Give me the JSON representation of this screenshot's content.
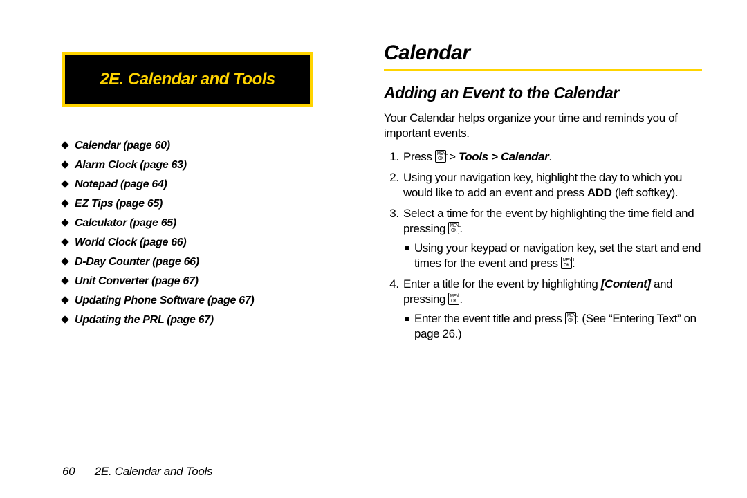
{
  "banner": {
    "title": "2E.  Calendar and Tools"
  },
  "toc": [
    "Calendar (page 60)",
    "Alarm Clock (page 63)",
    "Notepad (page 64)",
    "EZ Tips (page 65)",
    "Calculator (page 65)",
    "World Clock (page 66)",
    "D-Day Counter (page 66)",
    "Unit Converter (page 67)",
    "Updating Phone Software (page 67)",
    "Updating the PRL (page 67)"
  ],
  "heading1": "Calendar",
  "heading2": "Adding an Event to the Calendar",
  "intro": "Your Calendar helps organize your time and reminds you of important events.",
  "steps": {
    "s1": {
      "a": "Press ",
      "key": "MENU OK",
      "b": " > ",
      "tools": "Tools > Calendar",
      "c": "."
    },
    "s2": {
      "a": "Using your navigation key, highlight the day to which you would like to add an event and press ",
      "add": "ADD",
      "b": " (left softkey)."
    },
    "s3": {
      "a": "Select a time for the event by highlighting the time field and pressing ",
      "key": "MENU OK",
      "b": ".",
      "sub": {
        "a": "Using your keypad or navigation key, set the start and end times for the event and press ",
        "key": "MENU OK",
        "b": "."
      }
    },
    "s4": {
      "a": "Enter a title for the event by highlighting ",
      "content": "[Content]",
      "b": " and pressing ",
      "key": "MENU OK",
      "c": ".",
      "sub": {
        "a": "Enter the event title and press ",
        "key": "MENU OK",
        "b": ". (See “Entering Text” on page 26.)"
      }
    }
  },
  "keycap": {
    "top": "MENU",
    "bottom": "OK"
  },
  "footer": {
    "page": "60",
    "title": "2E. Calendar and Tools"
  }
}
